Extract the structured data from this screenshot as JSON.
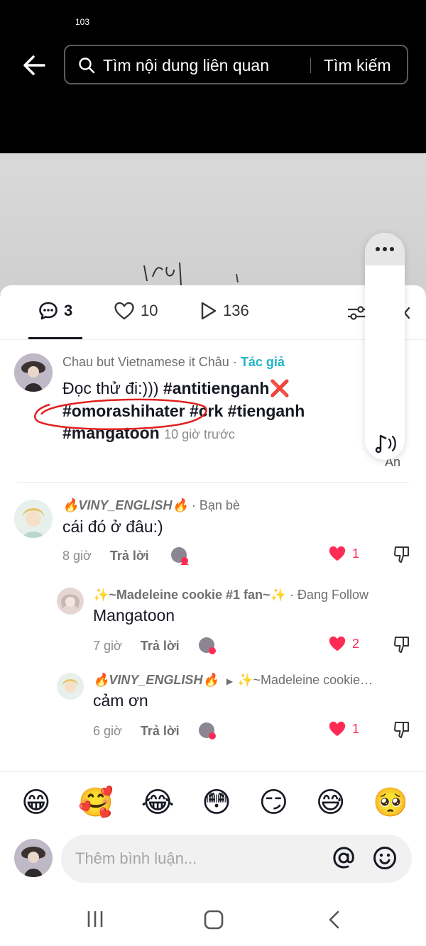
{
  "status_bar": {
    "time": "103"
  },
  "search": {
    "placeholder": "Tìm nội dung liên quan",
    "button_label": "Tìm kiếm"
  },
  "tabs": {
    "comments_count": "3",
    "likes_count": "10",
    "plays_count": "136"
  },
  "floating": {
    "hide_label": "Ẩn"
  },
  "caption": {
    "author": "Chau but Vietnamese it Châu",
    "separator": " · ",
    "author_tag": "Tác giả",
    "text_prefix": "Đọc thử đi:))) ",
    "hashtags_line1": "#antitienganh",
    "cross_emoji": "❌",
    "hashtags_line2": "#omorashihater #crk #tienganh",
    "hashtags_line3": "#mangatoon",
    "time": "10 giờ trước"
  },
  "comments": [
    {
      "author": "🔥VINY_ENGLISH🔥",
      "relation": " · Bạn bè",
      "text": "cái đó ở đâu:)",
      "time": "8 giờ",
      "reply_label": "Trả lời",
      "likes": "1"
    },
    {
      "author": "✨~Madeleine cookie #1 fan~✨",
      "relation": " · Đang Follow",
      "text": "Mangatoon",
      "time": "7 giờ",
      "reply_label": "Trả lời",
      "likes": "2"
    },
    {
      "author": "🔥VINY_ENGLISH🔥",
      "reply_to": "✨~Madeleine cookie…",
      "text": "cảm ơn",
      "time": "6 giờ",
      "reply_label": "Trả lời",
      "likes": "1"
    }
  ],
  "emojis": [
    "😁",
    "🥰",
    "😂",
    "😳",
    "😏",
    "😅",
    "🥺"
  ],
  "input": {
    "placeholder": "Thêm bình luận..."
  },
  "colors": {
    "accent_teal": "#20b4c8",
    "like_red": "#fe2c55"
  },
  "icons": [
    "back-arrow-icon",
    "search-icon",
    "comment-icon",
    "heart-icon",
    "play-icon",
    "filter-icon",
    "close-icon",
    "more-icon",
    "audio-icon",
    "heart-filled-icon",
    "dislike-icon",
    "mention-icon",
    "emoji-icon"
  ]
}
